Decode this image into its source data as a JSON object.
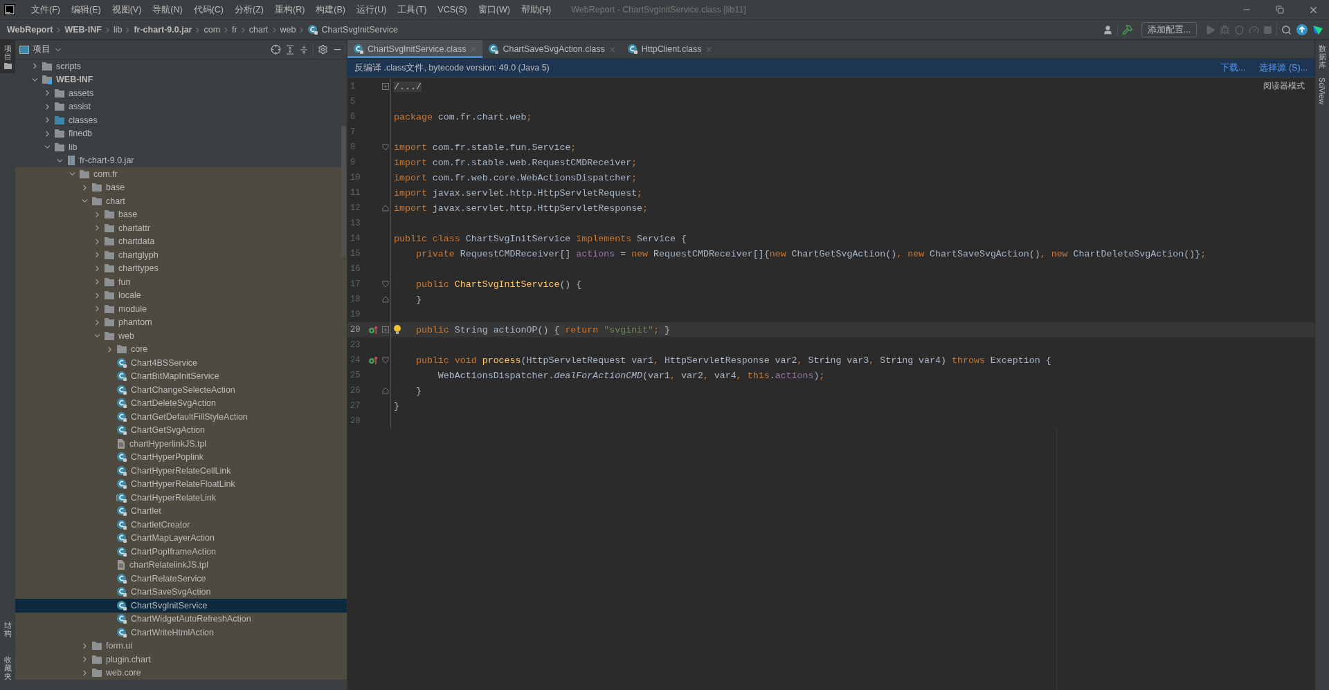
{
  "window": {
    "title": "WebReport - ChartSvgInitService.class [lib11]"
  },
  "menu": [
    "文件(F)",
    "编辑(E)",
    "视图(V)",
    "导航(N)",
    "代码(C)",
    "分析(Z)",
    "重构(R)",
    "构建(B)",
    "运行(U)",
    "工具(T)",
    "VCS(S)",
    "窗口(W)",
    "帮助(H)"
  ],
  "breadcrumb": [
    {
      "label": "WebReport",
      "bold": true,
      "kind": "folder"
    },
    {
      "label": "WEB-INF",
      "bold": true,
      "kind": "folder"
    },
    {
      "label": "lib",
      "bold": false,
      "kind": "folder"
    },
    {
      "label": "fr-chart-9.0.jar",
      "bold": true,
      "kind": "folder"
    },
    {
      "label": "com",
      "bold": false,
      "kind": "folder"
    },
    {
      "label": "fr",
      "bold": false,
      "kind": "folder"
    },
    {
      "label": "chart",
      "bold": false,
      "kind": "folder"
    },
    {
      "label": "web",
      "bold": false,
      "kind": "folder"
    },
    {
      "label": "ChartSvgInitService",
      "bold": false,
      "kind": "class"
    }
  ],
  "toolbar": {
    "config_button": "添加配置..."
  },
  "left_strip": {
    "top": "项目",
    "bottom": [
      "结构",
      "收藏夹"
    ]
  },
  "right_strip": {
    "items": [
      "数据库",
      "SciView"
    ]
  },
  "project_panel": {
    "title": "项目",
    "tree": [
      {
        "label": "scripts",
        "kind": "folder",
        "expanded": false,
        "selected": false
      },
      {
        "label": "WEB-INF",
        "kind": "web-folder",
        "expanded": true,
        "selected": false,
        "children": [
          {
            "label": "assets",
            "kind": "folder",
            "expanded": false,
            "selected": false
          },
          {
            "label": "assist",
            "kind": "folder",
            "expanded": false,
            "selected": false
          },
          {
            "label": "classes",
            "kind": "source-folder",
            "expanded": false,
            "selected": false
          },
          {
            "label": "finedb",
            "kind": "folder",
            "expanded": false,
            "selected": false
          },
          {
            "label": "lib",
            "kind": "folder",
            "expanded": true,
            "selected": false,
            "children": [
              {
                "label": "fr-chart-9.0.jar",
                "kind": "jar",
                "expanded": true,
                "selected": false,
                "children": [
                  {
                    "label": "com.fr",
                    "kind": "folder",
                    "expanded": true,
                    "selected": false,
                    "children": [
                      {
                        "label": "base",
                        "kind": "folder",
                        "expanded": false,
                        "selected": false
                      },
                      {
                        "label": "chart",
                        "kind": "folder",
                        "expanded": true,
                        "selected": false,
                        "children": [
                          {
                            "label": "base",
                            "kind": "folder",
                            "expanded": false,
                            "selected": false
                          },
                          {
                            "label": "chartattr",
                            "kind": "folder",
                            "expanded": false,
                            "selected": false
                          },
                          {
                            "label": "chartdata",
                            "kind": "folder",
                            "expanded": false,
                            "selected": false
                          },
                          {
                            "label": "chartglyph",
                            "kind": "folder",
                            "expanded": false,
                            "selected": false
                          },
                          {
                            "label": "charttypes",
                            "kind": "folder",
                            "expanded": false,
                            "selected": false
                          },
                          {
                            "label": "fun",
                            "kind": "folder",
                            "expanded": false,
                            "selected": false
                          },
                          {
                            "label": "locale",
                            "kind": "folder",
                            "expanded": false,
                            "selected": false
                          },
                          {
                            "label": "module",
                            "kind": "folder",
                            "expanded": false,
                            "selected": false
                          },
                          {
                            "label": "phantom",
                            "kind": "folder",
                            "expanded": false,
                            "selected": false
                          },
                          {
                            "label": "web",
                            "kind": "folder",
                            "expanded": true,
                            "selected": false,
                            "children": [
                              {
                                "label": "core",
                                "kind": "folder",
                                "expanded": false,
                                "selected": false
                              },
                              {
                                "label": "Chart4BSService",
                                "kind": "class",
                                "selected": false
                              },
                              {
                                "label": "ChartBitMapInitService",
                                "kind": "class",
                                "selected": false
                              },
                              {
                                "label": "ChartChangeSelecteAction",
                                "kind": "class",
                                "selected": false
                              },
                              {
                                "label": "ChartDeleteSvgAction",
                                "kind": "class",
                                "selected": false
                              },
                              {
                                "label": "ChartGetDefaultFillStyleAction",
                                "kind": "class",
                                "selected": false
                              },
                              {
                                "label": "ChartGetSvgAction",
                                "kind": "class",
                                "selected": false
                              },
                              {
                                "label": "chartHyperlinkJS.tpl",
                                "kind": "template",
                                "selected": false
                              },
                              {
                                "label": "ChartHyperPoplink",
                                "kind": "class",
                                "selected": false
                              },
                              {
                                "label": "ChartHyperRelateCellLink",
                                "kind": "class",
                                "selected": false
                              },
                              {
                                "label": "ChartHyperRelateFloatLink",
                                "kind": "class",
                                "selected": false
                              },
                              {
                                "label": "ChartHyperRelateLink",
                                "kind": "abstract-class",
                                "selected": false
                              },
                              {
                                "label": "Chartlet",
                                "kind": "class",
                                "selected": false
                              },
                              {
                                "label": "ChartletCreator",
                                "kind": "class",
                                "selected": false
                              },
                              {
                                "label": "ChartMapLayerAction",
                                "kind": "class",
                                "selected": false
                              },
                              {
                                "label": "ChartPopIframeAction",
                                "kind": "class",
                                "selected": false
                              },
                              {
                                "label": "chartRelatelinkJS.tpl",
                                "kind": "template",
                                "selected": false
                              },
                              {
                                "label": "ChartRelateService",
                                "kind": "class",
                                "selected": false
                              },
                              {
                                "label": "ChartSaveSvgAction",
                                "kind": "class",
                                "selected": false
                              },
                              {
                                "label": "ChartSvgInitService",
                                "kind": "class",
                                "selected": true
                              },
                              {
                                "label": "ChartWidgetAutoRefreshAction",
                                "kind": "class",
                                "selected": false
                              },
                              {
                                "label": "ChartWriteHtmlAction",
                                "kind": "class",
                                "selected": false
                              }
                            ]
                          }
                        ]
                      },
                      {
                        "label": "form.ui",
                        "kind": "folder",
                        "expanded": false,
                        "selected": false
                      },
                      {
                        "label": "plugin.chart",
                        "kind": "folder",
                        "expanded": false,
                        "selected": false
                      },
                      {
                        "label": "web.core",
                        "kind": "folder",
                        "expanded": false,
                        "selected": false
                      }
                    ]
                  }
                ]
              }
            ]
          }
        ]
      }
    ]
  },
  "editor": {
    "tabs": [
      {
        "label": "ChartSvgInitService.class",
        "selected": true
      },
      {
        "label": "ChartSaveSvgAction.class",
        "selected": false
      },
      {
        "label": "HttpClient.class",
        "selected": false
      }
    ],
    "info_bar": {
      "message": "反编译 .class文件, bytecode version: 49.0 (Java 5)",
      "links": [
        "下载...",
        "选择源 (S)..."
      ]
    },
    "reader_mode": "阅读器模式",
    "lines": [
      {
        "number": "1",
        "highlighted": false,
        "fold": {
          "kind": "collapsed"
        },
        "tokens": [
          {
            "kind": "folded",
            "text": "/.../"
          }
        ]
      },
      {
        "number": "5",
        "highlighted": false
      },
      {
        "number": "6",
        "highlighted": false,
        "tokens": [
          {
            "kind": "keyword",
            "text": "package"
          },
          {
            "kind": "plain",
            "text": " com.fr.chart.web"
          },
          {
            "kind": "keyword",
            "text": ";"
          }
        ]
      },
      {
        "number": "7",
        "highlighted": false
      },
      {
        "number": "8",
        "highlighted": false,
        "fold": {
          "kind": "open"
        },
        "tokens": [
          {
            "kind": "keyword",
            "text": "import"
          },
          {
            "kind": "plain",
            "text": " com.fr.stable.fun.Service"
          },
          {
            "kind": "keyword",
            "text": ";"
          }
        ]
      },
      {
        "number": "9",
        "highlighted": false,
        "tokens": [
          {
            "kind": "keyword",
            "text": "import"
          },
          {
            "kind": "plain",
            "text": " com.fr.stable.web.RequestCMDReceiver"
          },
          {
            "kind": "keyword",
            "text": ";"
          }
        ]
      },
      {
        "number": "10",
        "highlighted": false,
        "tokens": [
          {
            "kind": "keyword",
            "text": "import"
          },
          {
            "kind": "plain",
            "text": " com.fr.web.core.WebActionsDispatcher"
          },
          {
            "kind": "keyword",
            "text": ";"
          }
        ]
      },
      {
        "number": "11",
        "highlighted": false,
        "tokens": [
          {
            "kind": "keyword",
            "text": "import"
          },
          {
            "kind": "plain",
            "text": " javax.servlet.http.HttpServletRequest"
          },
          {
            "kind": "keyword",
            "text": ";"
          }
        ]
      },
      {
        "number": "12",
        "highlighted": false,
        "fold": {
          "kind": "close"
        },
        "tokens": [
          {
            "kind": "keyword",
            "text": "import"
          },
          {
            "kind": "plain",
            "text": " javax.servlet.http.HttpServletResponse"
          },
          {
            "kind": "keyword",
            "text": ";"
          }
        ]
      },
      {
        "number": "13",
        "highlighted": false
      },
      {
        "number": "14",
        "highlighted": false,
        "tokens": [
          {
            "kind": "keyword",
            "text": "public class"
          },
          {
            "kind": "plain",
            "text": " ChartSvgInitService "
          },
          {
            "kind": "keyword",
            "text": "implements"
          },
          {
            "kind": "plain",
            "text": " Service {"
          }
        ]
      },
      {
        "number": "15",
        "highlighted": false,
        "tokens": [
          {
            "kind": "keyword",
            "text": "    private"
          },
          {
            "kind": "plain",
            "text": " RequestCMDReceiver[] "
          },
          {
            "kind": "field",
            "text": "actions"
          },
          {
            "kind": "plain",
            "text": " = "
          },
          {
            "kind": "keyword",
            "text": "new"
          },
          {
            "kind": "plain",
            "text": " RequestCMDReceiver[]{"
          },
          {
            "kind": "keyword",
            "text": "new"
          },
          {
            "kind": "plain",
            "text": " ChartGetSvgAction()"
          },
          {
            "kind": "keyword",
            "text": ", new"
          },
          {
            "kind": "plain",
            "text": " ChartSaveSvgAction()"
          },
          {
            "kind": "keyword",
            "text": ", new"
          },
          {
            "kind": "plain",
            "text": " ChartDeleteSvgAction()}"
          },
          {
            "kind": "keyword",
            "text": ";"
          }
        ]
      },
      {
        "number": "16",
        "highlighted": false
      },
      {
        "number": "17",
        "highlighted": false,
        "fold": {
          "kind": "open"
        },
        "tokens": [
          {
            "kind": "keyword",
            "text": "    public"
          },
          {
            "kind": "declaration",
            "text": " ChartSvgInitService"
          },
          {
            "kind": "plain",
            "text": "() {"
          }
        ]
      },
      {
        "number": "18",
        "highlighted": false,
        "fold": {
          "kind": "close"
        },
        "tokens": [
          {
            "kind": "plain",
            "text": "    }"
          }
        ]
      },
      {
        "number": "19",
        "highlighted": false
      },
      {
        "number": "20",
        "highlighted": true,
        "fold": {
          "kind": "collapsed"
        },
        "gutter_icon": {
          "kind": "override"
        },
        "bulb": true,
        "tokens": [
          {
            "kind": "keyword",
            "text": "    public"
          },
          {
            "kind": "plain",
            "text": " String actionOP() "
          },
          {
            "kind": "brace",
            "text": "{ "
          },
          {
            "kind": "keyword",
            "text": "return"
          },
          {
            "kind": "string",
            "text": " \"svginit\""
          },
          {
            "kind": "keyword",
            "text": ";"
          },
          {
            "kind": "brace",
            "text": " }"
          }
        ]
      },
      {
        "number": "23",
        "highlighted": false
      },
      {
        "number": "24",
        "highlighted": false,
        "fold": {
          "kind": "open"
        },
        "gutter_icon": {
          "kind": "override"
        },
        "tokens": [
          {
            "kind": "keyword",
            "text": "    public void"
          },
          {
            "kind": "declaration",
            "text": " process"
          },
          {
            "kind": "plain",
            "text": "(HttpServletRequest var1"
          },
          {
            "kind": "keyword",
            "text": ","
          },
          {
            "kind": "plain",
            "text": " HttpServletResponse var2"
          },
          {
            "kind": "keyword",
            "text": ","
          },
          {
            "kind": "plain",
            "text": " String var3"
          },
          {
            "kind": "keyword",
            "text": ","
          },
          {
            "kind": "plain",
            "text": " String var4) "
          },
          {
            "kind": "keyword",
            "text": "throws"
          },
          {
            "kind": "plain",
            "text": " Exception {"
          }
        ]
      },
      {
        "number": "25",
        "highlighted": false,
        "tokens": [
          {
            "kind": "plain",
            "text": "        WebActionsDispatcher."
          },
          {
            "kind": "italic",
            "text": "dealForActionCMD"
          },
          {
            "kind": "plain",
            "text": "(var1"
          },
          {
            "kind": "keyword",
            "text": ","
          },
          {
            "kind": "plain",
            "text": " var2"
          },
          {
            "kind": "keyword",
            "text": ","
          },
          {
            "kind": "plain",
            "text": " var4"
          },
          {
            "kind": "keyword",
            "text": ", this"
          },
          {
            "kind": "plain",
            "text": "."
          },
          {
            "kind": "field",
            "text": "actions"
          },
          {
            "kind": "plain",
            "text": ")"
          },
          {
            "kind": "keyword",
            "text": ";"
          }
        ]
      },
      {
        "number": "26",
        "highlighted": false,
        "fold": {
          "kind": "close"
        },
        "tokens": [
          {
            "kind": "plain",
            "text": "    }"
          }
        ]
      },
      {
        "number": "27",
        "highlighted": false,
        "tokens": [
          {
            "kind": "plain",
            "text": "}"
          }
        ]
      },
      {
        "number": "28",
        "highlighted": false
      }
    ]
  }
}
